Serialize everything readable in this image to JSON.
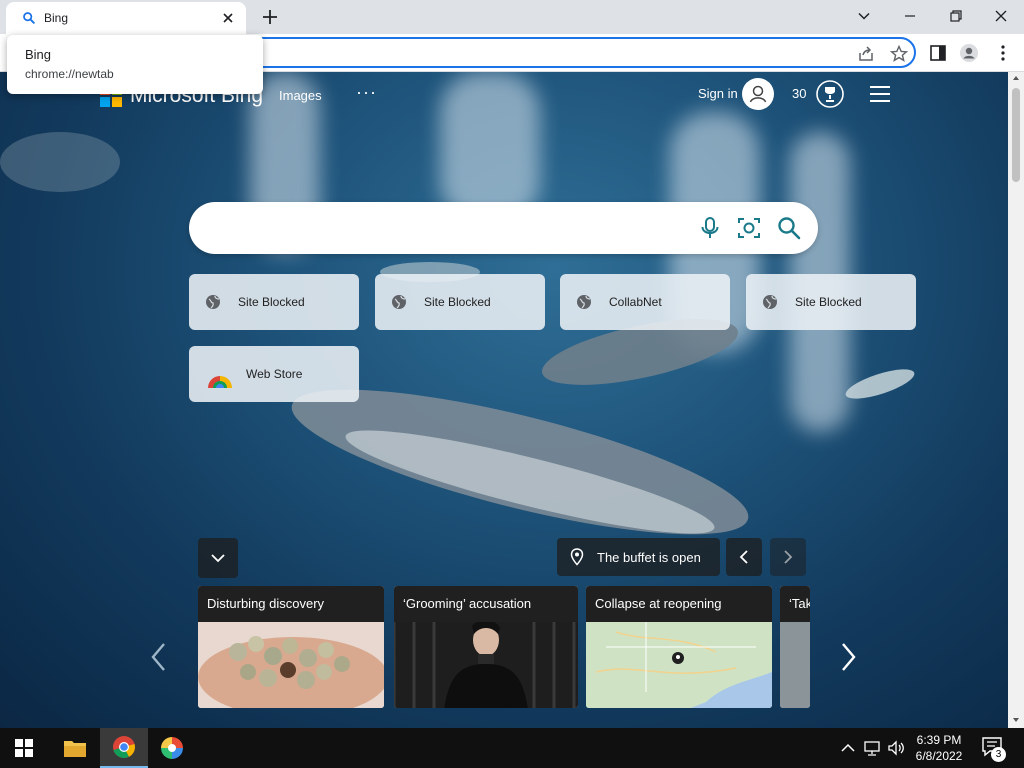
{
  "browser": {
    "tab_title": "Bing",
    "tooltip_title": "Bing",
    "tooltip_url": "chrome://newtab"
  },
  "header": {
    "logo_text": "Microsoft Bing",
    "nav_images": "Images",
    "nav_more": "···",
    "signin": "Sign in",
    "rewards_count": "30"
  },
  "tiles": [
    {
      "label": "Site Blocked",
      "icon": "globe-icon"
    },
    {
      "label": "Site Blocked",
      "icon": "globe-icon"
    },
    {
      "label": "CollabNet",
      "icon": "globe-icon"
    },
    {
      "label": "Site Blocked",
      "icon": "globe-icon"
    },
    {
      "label": "Web Store",
      "icon": "chrome-icon"
    }
  ],
  "image_info": {
    "location_label": "The buffet is open"
  },
  "news": [
    {
      "title": "Disturbing discovery"
    },
    {
      "title": "‘Grooming’ accusation"
    },
    {
      "title": "Collapse at reopening"
    },
    {
      "title": "‘Tak"
    }
  ],
  "taskbar": {
    "time": "6:39 PM",
    "date": "6/8/2022",
    "notification_count": "3"
  },
  "colors": {
    "omnibox_border": "#1a73e8",
    "bing_teal": "#1a7a8a",
    "taskbar": "#101010"
  }
}
